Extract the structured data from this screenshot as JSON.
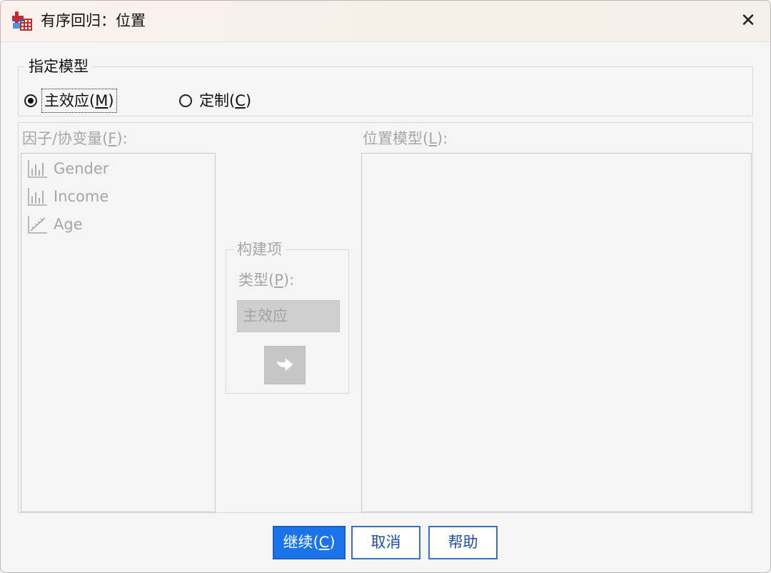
{
  "window": {
    "title": "有序回归：位置",
    "close_glyph": "✕"
  },
  "model_group": {
    "label": "指定模型",
    "main_effects": {
      "prefix": "主效应(",
      "mnemonic": "M",
      "suffix": ")",
      "checked": true
    },
    "custom": {
      "prefix": "定制(",
      "mnemonic": "C",
      "suffix": ")",
      "checked": false
    }
  },
  "factors": {
    "label_prefix": "因子/协变量(",
    "label_mnemonic": "F",
    "label_suffix": "):",
    "items": [
      {
        "name": "Gender",
        "icon": "ordinal-bar-icon"
      },
      {
        "name": "Income",
        "icon": "ordinal-bar-icon"
      },
      {
        "name": "Age",
        "icon": "scale-ruler-icon"
      }
    ]
  },
  "location_model": {
    "label_prefix": "位置模型(",
    "label_mnemonic": "L",
    "label_suffix": "):"
  },
  "build_terms": {
    "label": "构建项",
    "type_label_prefix": "类型(",
    "type_label_mnemonic": "P",
    "type_label_suffix": "):",
    "type_value": "主效应",
    "move_icon": "arrow-right-icon"
  },
  "buttons": {
    "continue": {
      "prefix": "继续(",
      "mnemonic": "C",
      "suffix": ")"
    },
    "cancel": "取消",
    "help": "帮助"
  },
  "colors": {
    "primary": "#1a73e8",
    "disabled_text": "#a6a6a6",
    "button_border": "#3b6fc4"
  }
}
